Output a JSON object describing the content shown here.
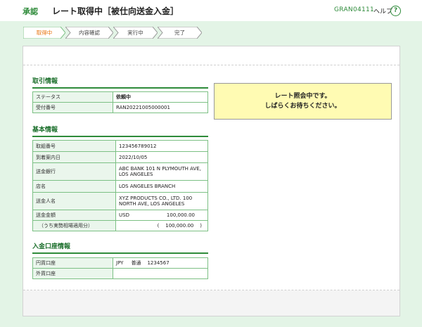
{
  "header": {
    "brand": "承認",
    "title": "レート取得中［被仕向送金入金］",
    "screen_id": "GRAN04111",
    "help_label": "ヘルプ",
    "help_icon_glyph": "?"
  },
  "steps": [
    {
      "label": "取得中",
      "active": true
    },
    {
      "label": "内容確認",
      "active": false
    },
    {
      "label": "実行中",
      "active": false
    },
    {
      "label": "完了",
      "active": false
    }
  ],
  "transaction_info": {
    "title": "取引情報",
    "rows": [
      {
        "label": "ステータス",
        "value": "依頼中"
      },
      {
        "label": "受付番号",
        "value": "RAN20221005000001"
      }
    ]
  },
  "basic_info": {
    "title": "基本情報",
    "rows": [
      {
        "label": "取組番号",
        "value": "123456789012"
      },
      {
        "label": "到着案内日",
        "value": "2022/10/05"
      },
      {
        "label": "送金銀行",
        "value": "ABC BANK 101 N PLYMOUTH AVE, LOS ANGELES"
      },
      {
        "label": "店名",
        "value": "LOS ANGELES BRANCH"
      },
      {
        "label": "送金人名",
        "value": "XYZ PRODUCTS CO., LTD. 100 NORTH AVE, LOS ANGELES"
      },
      {
        "label": "送金金額",
        "currency": "USD",
        "amount": "100,000.00"
      },
      {
        "label": "（うち実勢相場適用分）",
        "paren_open": "(",
        "amount": "100,000.00",
        "paren_close": ")"
      }
    ]
  },
  "deposit_account": {
    "title": "入金口座情報",
    "rows": [
      {
        "label": "円貨口座",
        "currency": "JPY",
        "type": "普通",
        "number": "1234567"
      },
      {
        "label": "外貨口座",
        "value": ""
      }
    ]
  },
  "notice": {
    "line1": "レート照会中です。",
    "line2": "しばらくお待ちください。"
  },
  "colors": {
    "accent": "#2e8b3a",
    "background": "#e3f4e6",
    "active_step_text": "#e8720c",
    "notice_bg": "#fffbb3"
  }
}
